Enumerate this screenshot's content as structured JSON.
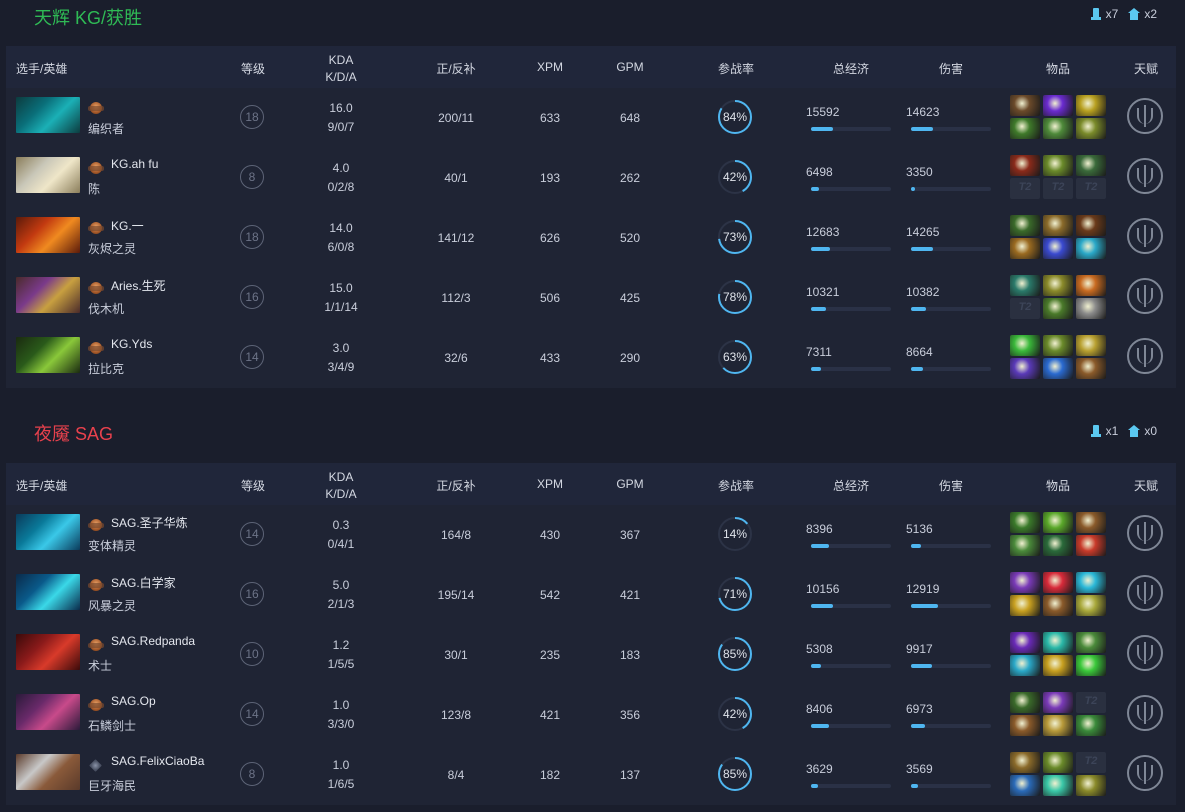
{
  "colors": {
    "accent": "#4fb6f0",
    "radiant": "#2fba55",
    "dire": "#e8414d"
  },
  "headers": {
    "player": "选手/英雄",
    "level": "等级",
    "kda_line1": "KDA",
    "kda_line2": "K/D/A",
    "lasthits": "正/反补",
    "xpm": "XPM",
    "gpm": "GPM",
    "participation": "参战率",
    "networth": "总经济",
    "damage": "伤害",
    "items": "物品",
    "talent": "天赋"
  },
  "teams": [
    {
      "title": "天辉 KG/获胜",
      "towers": "x7",
      "barracks": "x2",
      "players": [
        {
          "name": "",
          "hero": "编织者",
          "level": "18",
          "kda": "16.0",
          "kda_detail": "9/0/7",
          "lasthits": "200/11",
          "xpm": "633",
          "gpm": "648",
          "participation": "84%",
          "part_value": 0.84,
          "networth": "15592",
          "nw_fill": 0.28,
          "damage": "14623",
          "dmg_fill": 0.28,
          "portrait": [
            "#0a6f7a",
            "#1bb0b6",
            "#0c3b3e"
          ],
          "medal": "bronze",
          "items": [
            "#6b4a2a",
            "#6a2bd0",
            "#b8a020",
            "#3f7a2a",
            "#4e8a3a",
            "#7a8a2a"
          ]
        },
        {
          "name": "KG.ah fu",
          "hero": "陈",
          "level": "8",
          "kda": "4.0",
          "kda_detail": "0/2/8",
          "lasthits": "40/1",
          "xpm": "193",
          "gpm": "262",
          "participation": "42%",
          "part_value": 0.42,
          "networth": "6498",
          "nw_fill": 0.1,
          "damage": "3350",
          "dmg_fill": 0.05,
          "portrait": [
            "#c9c7b8",
            "#efe6c8",
            "#8a7d5a"
          ],
          "medal": "bronze",
          "items": [
            "#8a2a1a",
            "#6a8a2a",
            "#3a6a3a",
            "empty",
            "empty",
            "empty"
          ]
        },
        {
          "name": "KG.一",
          "hero": "灰烬之灵",
          "level": "18",
          "kda": "14.0",
          "kda_detail": "6/0/8",
          "lasthits": "141/12",
          "xpm": "626",
          "gpm": "520",
          "participation": "73%",
          "part_value": 0.73,
          "networth": "12683",
          "nw_fill": 0.24,
          "damage": "14265",
          "dmg_fill": 0.27,
          "portrait": [
            "#c23a10",
            "#f08a20",
            "#5a1a0a"
          ],
          "medal": "bronze",
          "items": [
            "#3a6a2a",
            "#8a6a2a",
            "#6a3a1a",
            "#9a6a20",
            "#3a4ad0",
            "#2aa8c8"
          ]
        },
        {
          "name": "Aries.生死",
          "hero": "伐木机",
          "level": "16",
          "kda": "15.0",
          "kda_detail": "1/1/14",
          "lasthits": "112/3",
          "xpm": "506",
          "gpm": "425",
          "participation": "78%",
          "part_value": 0.78,
          "networth": "10321",
          "nw_fill": 0.19,
          "damage": "10382",
          "dmg_fill": 0.19,
          "portrait": [
            "#7a3a8a",
            "#c8a040",
            "#4a2a2a"
          ],
          "medal": "bronze",
          "items": [
            "#2a7a6a",
            "#8a8a2a",
            "#c86a20",
            "empty",
            "#4a7a2a",
            "#8a8a8a"
          ]
        },
        {
          "name": "KG.Yds",
          "hero": "拉比克",
          "level": "14",
          "kda": "3.0",
          "kda_detail": "3/4/9",
          "lasthits": "32/6",
          "xpm": "433",
          "gpm": "290",
          "participation": "63%",
          "part_value": 0.63,
          "networth": "7311",
          "nw_fill": 0.12,
          "damage": "8664",
          "dmg_fill": 0.15,
          "portrait": [
            "#2a5a1a",
            "#8ac83a",
            "#1a2a10"
          ],
          "medal": "bronze",
          "items": [
            "#3ab83a",
            "#6a8a2a",
            "#b8a030",
            "#5a3ab8",
            "#2a6ad0",
            "#8a5a2a"
          ]
        }
      ]
    },
    {
      "title": "夜魇 SAG",
      "towers": "x1",
      "barracks": "x0",
      "players": [
        {
          "name": "SAG.圣子华炼",
          "hero": "变体精灵",
          "level": "14",
          "kda": "0.3",
          "kda_detail": "0/4/1",
          "lasthits": "164/8",
          "xpm": "430",
          "gpm": "367",
          "participation": "14%",
          "part_value": 0.14,
          "networth": "8396",
          "nw_fill": 0.22,
          "damage": "5136",
          "dmg_fill": 0.12,
          "portrait": [
            "#0a7a9a",
            "#3ac8e8",
            "#0a3a5a"
          ],
          "medal": "bronze",
          "items": [
            "#3a7a2a",
            "#5aa82a",
            "#8a5a2a",
            "#4a8a3a",
            "#2a6a3a",
            "#c83a2a"
          ]
        },
        {
          "name": "SAG.白学家",
          "hero": "风暴之灵",
          "level": "16",
          "kda": "5.0",
          "kda_detail": "2/1/3",
          "lasthits": "195/14",
          "xpm": "542",
          "gpm": "421",
          "participation": "71%",
          "part_value": 0.71,
          "networth": "10156",
          "nw_fill": 0.27,
          "damage": "12919",
          "dmg_fill": 0.34,
          "portrait": [
            "#0a5a8a",
            "#3ad8e8",
            "#0a2a4a"
          ],
          "medal": "bronze",
          "items": [
            "#7a3ab8",
            "#d82a3a",
            "#2ab8d8",
            "#c8a020",
            "#8a5a2a",
            "#a8a83a"
          ]
        },
        {
          "name": "SAG.Redpanda",
          "hero": "术士",
          "level": "10",
          "kda": "1.2",
          "kda_detail": "1/5/5",
          "lasthits": "30/1",
          "xpm": "235",
          "gpm": "183",
          "participation": "85%",
          "part_value": 0.85,
          "networth": "5308",
          "nw_fill": 0.13,
          "damage": "9917",
          "dmg_fill": 0.26,
          "portrait": [
            "#8a1a1a",
            "#d83a2a",
            "#3a0a0a"
          ],
          "medal": "bronze",
          "items": [
            "#6a2ab8",
            "#2ab8a8",
            "#4a8a3a",
            "#2aa8c8",
            "#c8a020",
            "#3ac83a"
          ]
        },
        {
          "name": "SAG.Op",
          "hero": "石鳞剑士",
          "level": "14",
          "kda": "1.0",
          "kda_detail": "3/3/0",
          "lasthits": "123/8",
          "xpm": "421",
          "gpm": "356",
          "participation": "42%",
          "part_value": 0.42,
          "networth": "8406",
          "nw_fill": 0.22,
          "damage": "6973",
          "dmg_fill": 0.18,
          "portrait": [
            "#6a2a6a",
            "#c84a8a",
            "#2a1a3a"
          ],
          "medal": "bronze",
          "items": [
            "#3a6a2a",
            "#7a3ab8",
            "empty",
            "#8a5a2a",
            "#b89a3a",
            "#3a8a3a"
          ]
        },
        {
          "name": "SAG.FelixCiaoBa",
          "hero": "巨牙海民",
          "level": "8",
          "kda": "1.0",
          "kda_detail": "1/6/5",
          "lasthits": "8/4",
          "xpm": "182",
          "gpm": "137",
          "participation": "85%",
          "part_value": 0.85,
          "networth": "3629",
          "nw_fill": 0.09,
          "damage": "3569",
          "dmg_fill": 0.09,
          "portrait": [
            "#c8c8c8",
            "#8a5a3a",
            "#5a3a2a"
          ],
          "medal": "plain",
          "items": [
            "#8a6a2a",
            "#6a8a2a",
            "empty",
            "#2a6ab8",
            "#3ac8a8",
            "#8a8a2a"
          ]
        }
      ]
    }
  ]
}
